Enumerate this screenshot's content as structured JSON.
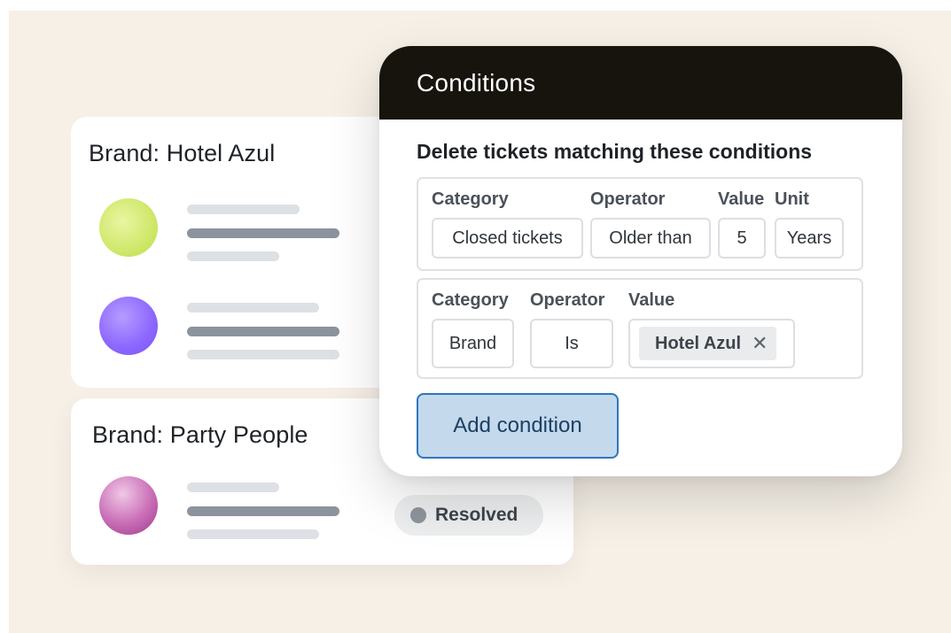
{
  "brand_cards": [
    {
      "title": "Brand: Hotel Azul"
    },
    {
      "title": "Brand: Party People",
      "status": "Resolved"
    }
  ],
  "modal": {
    "title": "Conditions",
    "subtitle": "Delete tickets matching these conditions",
    "condition_1": {
      "labels": {
        "category": "Category",
        "operator": "Operator",
        "value": "Value",
        "unit": "Unit"
      },
      "values": {
        "category": "Closed tickets",
        "operator": "Older than",
        "value": "5",
        "unit": "Years"
      }
    },
    "condition_2": {
      "labels": {
        "category": "Category",
        "operator": "Operator",
        "value": "Value"
      },
      "values": {
        "category": "Brand",
        "operator": "Is",
        "tag": "Hotel Azul",
        "tag_remove": "✕"
      }
    },
    "add_button_label": "Add condition"
  },
  "colors": {
    "background": "#f6f0e7",
    "modal_header": "#17140e",
    "add_button_fill": "#c4d9ec",
    "add_button_border": "#2f76be",
    "avatar_green": "#cfe86a",
    "avatar_purple": "#8c66ff",
    "avatar_magenta": "#c96db6",
    "status_dot": "#8e959c"
  },
  "icons": {
    "tag_remove": "close-icon",
    "status": "status-dot-icon"
  }
}
